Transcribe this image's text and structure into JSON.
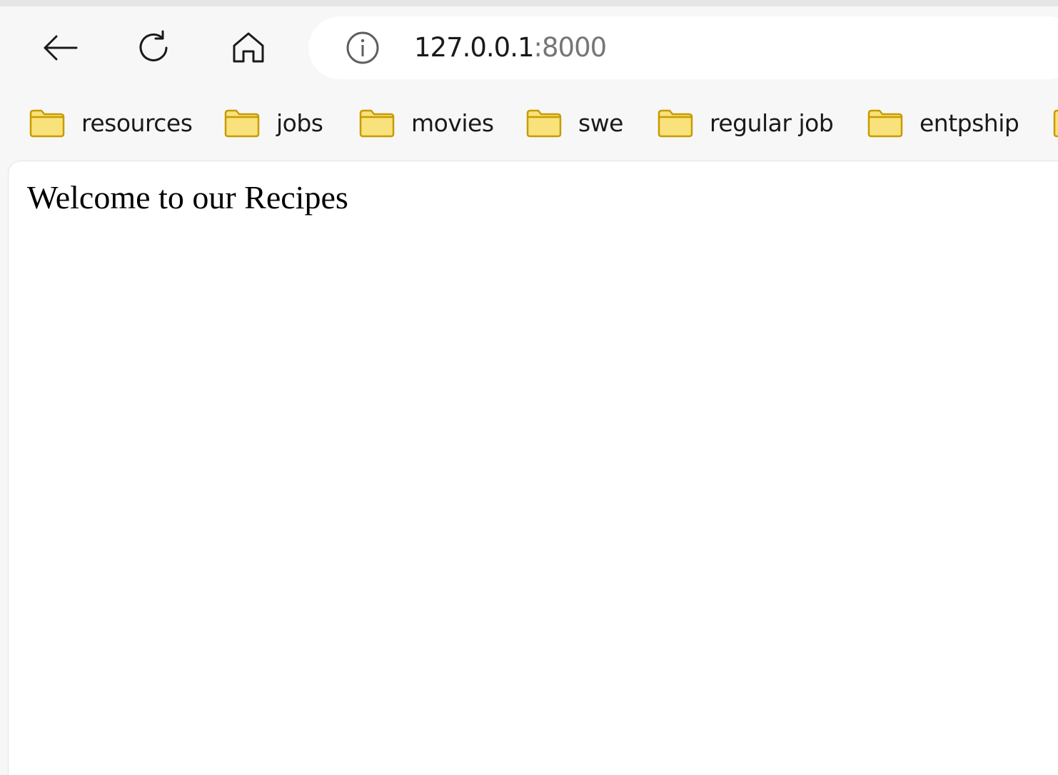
{
  "browser": {
    "address_bar": {
      "host": "127.0.0.1",
      "port": ":8000"
    },
    "bookmarks": [
      {
        "label": "resources",
        "icon": "folder-icon"
      },
      {
        "label": "jobs",
        "icon": "folder-icon"
      },
      {
        "label": "movies",
        "icon": "folder-icon"
      },
      {
        "label": "swe",
        "icon": "folder-icon"
      },
      {
        "label": "regular job",
        "icon": "folder-icon"
      },
      {
        "label": "entpship",
        "icon": "folder-icon"
      }
    ],
    "icons": {
      "back": "arrow-left-icon",
      "reload": "reload-icon",
      "home": "home-icon",
      "site_info": "info-icon"
    },
    "colors": {
      "chrome_bg": "#f7f7f7",
      "folder_fill": "#f9e27b",
      "folder_stroke": "#c89b00"
    }
  },
  "page": {
    "heading": "Welcome to our Recipes"
  }
}
